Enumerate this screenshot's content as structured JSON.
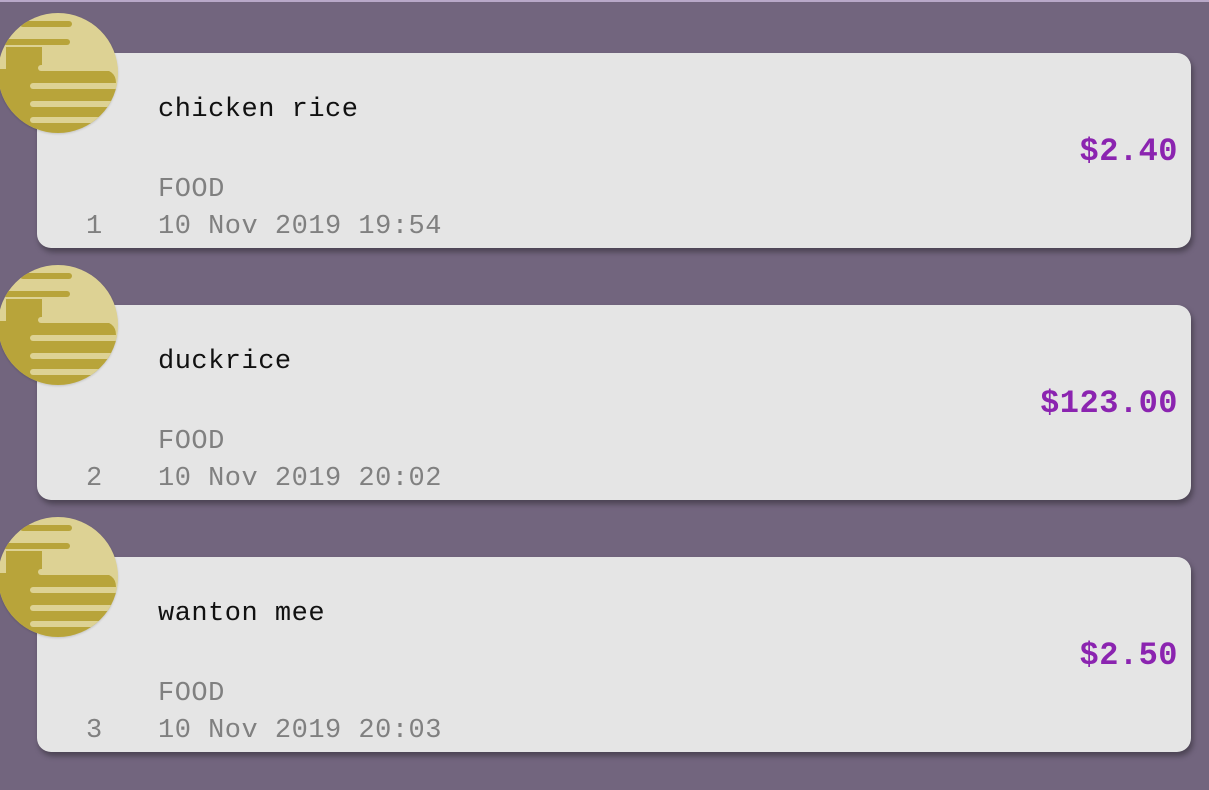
{
  "expenses": [
    {
      "index": "1",
      "description": "chicken rice",
      "category": "FOOD",
      "datetime": "10 Nov 2019 19:54",
      "amount": "$2.40",
      "icon": "food-icon"
    },
    {
      "index": "2",
      "description": "duckrice",
      "category": "FOOD",
      "datetime": "10 Nov 2019 20:02",
      "amount": "$123.00",
      "icon": "food-icon"
    },
    {
      "index": "3",
      "description": "wanton mee",
      "category": "FOOD",
      "datetime": "10 Nov 2019 20:03",
      "amount": "$2.50",
      "icon": "food-icon"
    }
  ],
  "colors": {
    "background": "#72657e",
    "card": "#e5e5e5",
    "amount": "#8b24b0",
    "icon_light": "#ddd294",
    "icon_dark": "#b8a43a"
  }
}
